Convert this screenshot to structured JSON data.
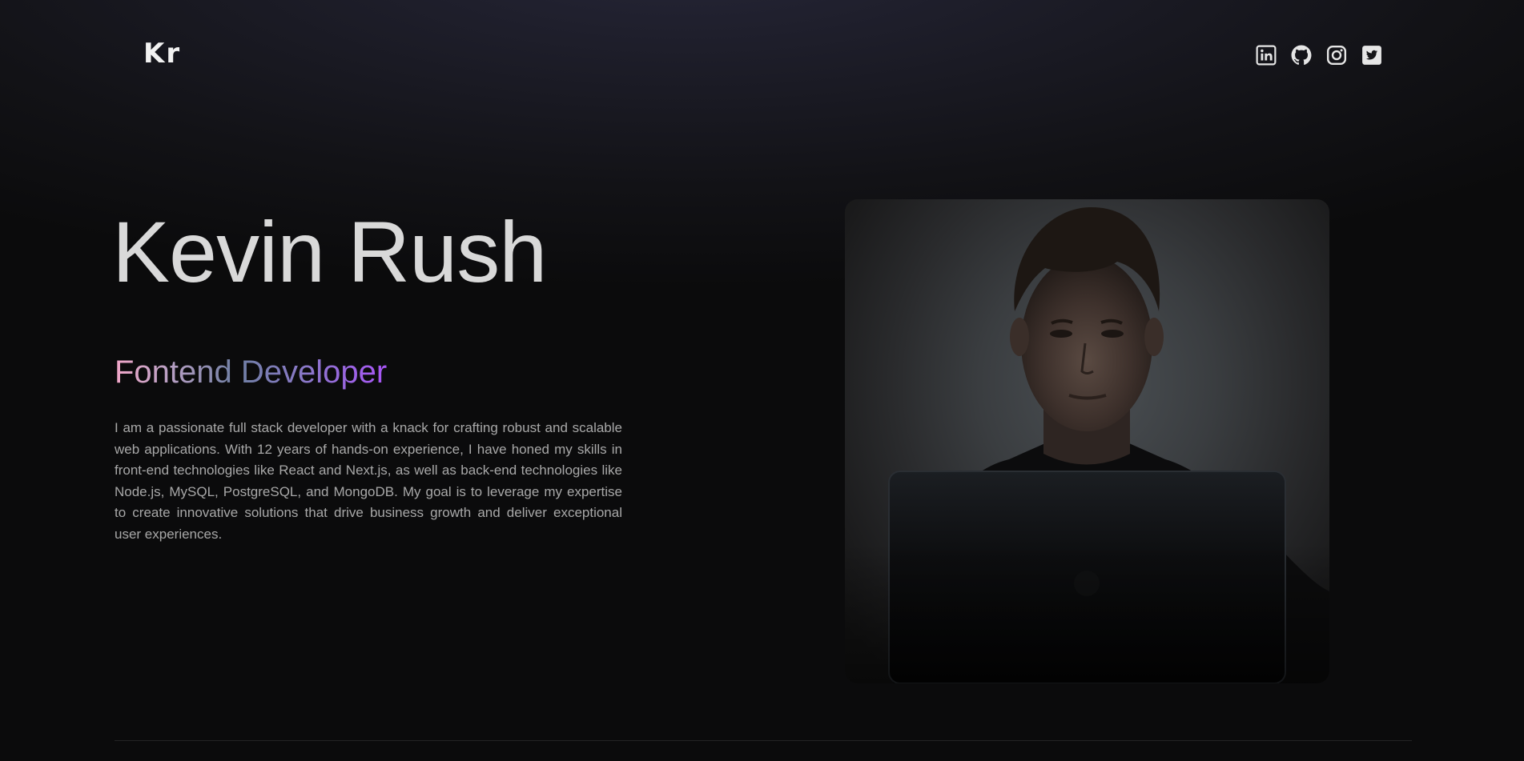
{
  "header": {
    "logo": "Kr",
    "socials": [
      {
        "name": "LinkedIn",
        "icon": "linkedin-icon"
      },
      {
        "name": "GitHub",
        "icon": "github-icon"
      },
      {
        "name": "Instagram",
        "icon": "instagram-icon"
      },
      {
        "name": "Twitter",
        "icon": "twitter-icon"
      }
    ]
  },
  "hero": {
    "name": "Kevin Rush",
    "role": "Fontend Developer",
    "bio": "I am a passionate full stack developer with a knack for crafting robust and scalable web applications. With 12 years of hands-on experience, I have honed my skills in front-end technologies like React and Next.js, as well as back-end technologies like Node.js, MySQL, PostgreSQL, and MongoDB. My goal is to leverage my expertise to create innovative solutions that drive business growth and deliver exceptional user experiences."
  },
  "colors": {
    "background": "#0b0b0c",
    "text": "#d9d9d9",
    "muted": "#a8a8a8",
    "gradient_start": "#f1a7c8",
    "gradient_end": "#a855f7"
  }
}
